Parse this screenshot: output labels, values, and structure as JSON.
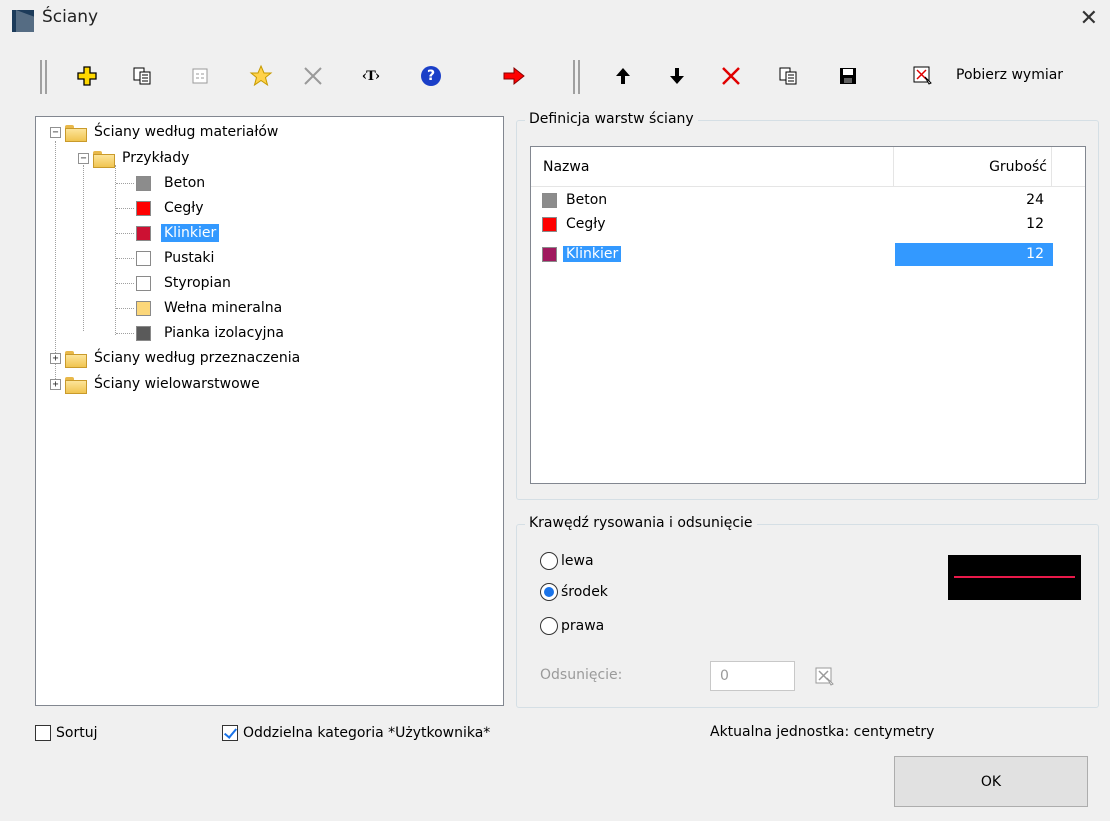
{
  "window": {
    "title": "Ściany",
    "close_symbol": "✕"
  },
  "toolbar": {
    "icons": [
      "add-icon",
      "copy-icon",
      "properties-icon",
      "favorite-icon",
      "delete-icon",
      "text-tag-icon",
      "help-icon",
      "transfer-arrow-icon",
      "move-up-icon",
      "move-down-icon",
      "remove-layer-icon",
      "copy-layer-icon",
      "save-icon",
      "pick-dimension-icon"
    ],
    "text_tag_label": "‹T›",
    "help_label": "?",
    "pick_dimension_label": "Pobierz wymiar"
  },
  "tree": {
    "root_materials": "Ściany według materiałów",
    "examples": "Przykłady",
    "items": [
      {
        "label": "Beton",
        "color": "#8c8c8c"
      },
      {
        "label": "Cegły",
        "color": "#ff0000"
      },
      {
        "label": "Klinkier",
        "color": "#cc1133",
        "selected": true
      },
      {
        "label": "Pustaki",
        "color": "#ffffff"
      },
      {
        "label": "Styropian",
        "color": "#ffffff"
      },
      {
        "label": "Wełna mineralna",
        "color": "#fcd77a"
      },
      {
        "label": "Pianka izolacyjna",
        "color": "#5a5a5a"
      }
    ],
    "root_purpose": "Ściany według przeznaczenia",
    "root_multilayer": "Ściany wielowarstwowe",
    "expand_collapsed": "+",
    "expand_open": "−"
  },
  "layers": {
    "group_title": "Definicja warstw ściany",
    "col_name": "Nazwa",
    "col_thickness": "Grubość",
    "rows": [
      {
        "name": "Beton",
        "thickness": "24",
        "color": "#8c8c8c"
      },
      {
        "name": "Cegły",
        "thickness": "12",
        "color": "#ff0000"
      },
      {
        "name": "Klinkier",
        "thickness": "12",
        "color": "#a0195e",
        "selected": true
      }
    ]
  },
  "edge": {
    "group_title": "Krawędź rysowania i odsunięcie",
    "options": [
      "lewa",
      "środek",
      "prawa"
    ],
    "selected": "środek",
    "offset_label": "Odsunięcie:",
    "offset_value": "0",
    "preview_line_color": "#e8194a"
  },
  "footer": {
    "sort_label": "Sortuj",
    "sort_checked": false,
    "separate_label": "Oddzielna kategoria *Użytkownika*",
    "separate_checked": true,
    "unit_text": "Aktualna jednostka: centymetry",
    "ok_label": "OK"
  }
}
